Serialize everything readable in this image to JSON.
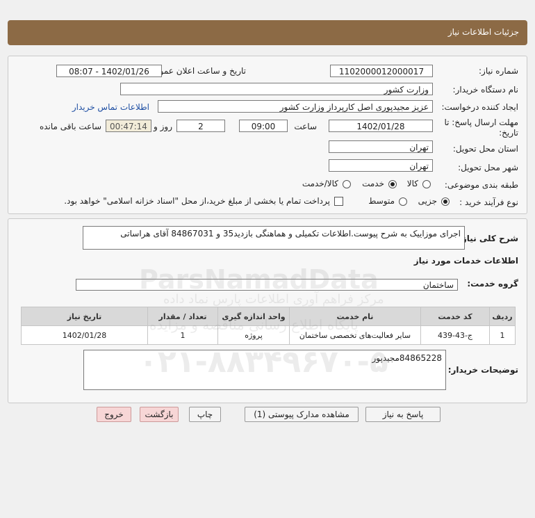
{
  "header": {
    "title": "جزئیات اطلاعات نیاز"
  },
  "need_info": {
    "need_number_label": "شماره نیاز:",
    "need_number": "1102000012000017",
    "announce_label": "تاریخ و ساعت اعلان عمومی:",
    "announce_value": "1402/01/26 - 08:07",
    "buyer_org_label": "نام دستگاه خریدار:",
    "buyer_org": "وزارت کشور",
    "requester_label": "ایجاد کننده درخواست:",
    "requester": "عزیز مجیدپوری اصل کارپرداز وزارت کشور",
    "contact_link": "اطلاعات تماس خریدار",
    "deadline_label_1": "مهلت ارسال پاسخ: تا",
    "deadline_label_2": "تاریخ:",
    "deadline_date": "1402/01/28",
    "time_label": "ساعت",
    "deadline_time": "09:00",
    "days": "2",
    "days_label": "روز و",
    "remaining": "00:47:14",
    "remaining_label": "ساعت باقی مانده",
    "province_label": "استان محل تحویل:",
    "province": "تهران",
    "city_label": "شهر محل تحویل:",
    "city": "تهران",
    "category_label": "طبقه بندی موضوعی:",
    "category_options": [
      "کالا",
      "خدمت",
      "کالا/خدمت"
    ],
    "category_selected": "خدمت",
    "process_label": "نوع فرآیند خرید :",
    "process_options": [
      "جزیی",
      "متوسط"
    ],
    "process_selected": "جزیی",
    "payment_note": "پرداخت تمام یا بخشی از مبلغ خرید،از محل \"اسناد خزانه اسلامی\" خواهد بود."
  },
  "summary": {
    "label": "شرح کلی نیاز:",
    "text": "اجرای موزاییک به شرح پیوست.اطلاعات تکمیلی و هماهنگی بازدید35 و 84867031 آقای هراساتی",
    "services_title": "اطلاعات خدمات مورد نیاز",
    "service_group_label": "گروه خدمت:",
    "service_group": "ساختمان"
  },
  "table": {
    "headers": [
      "ردیف",
      "کد خدمت",
      "نام خدمت",
      "واحد اندازه گیری",
      "تعداد / مقدار",
      "تاریخ نیاز"
    ],
    "rows": [
      [
        "1",
        "ج-43-439",
        "سایر فعالیت‌های تخصصی ساختمان",
        "پروژه",
        "1",
        "1402/01/28"
      ]
    ]
  },
  "buyer_notes": {
    "label": "توضیحات خریدار:",
    "text": "84865228مجیدپور"
  },
  "buttons": {
    "reply": "پاسخ به نیاز",
    "attachments": "مشاهده مدارک پیوستی (1)",
    "print": "چاپ",
    "back": "بازگشت",
    "exit": "خروج"
  },
  "watermark": {
    "brand": "ParsNamadData",
    "phone": "۰۲۱-۸۸۳۴۹۶۷۰-۵",
    "line1": "مرکز فراهم آوری اطلاعات پارس نماد داده",
    "line2": "پایگاه اطلاع رسانی مناقصه و مزایده"
  }
}
